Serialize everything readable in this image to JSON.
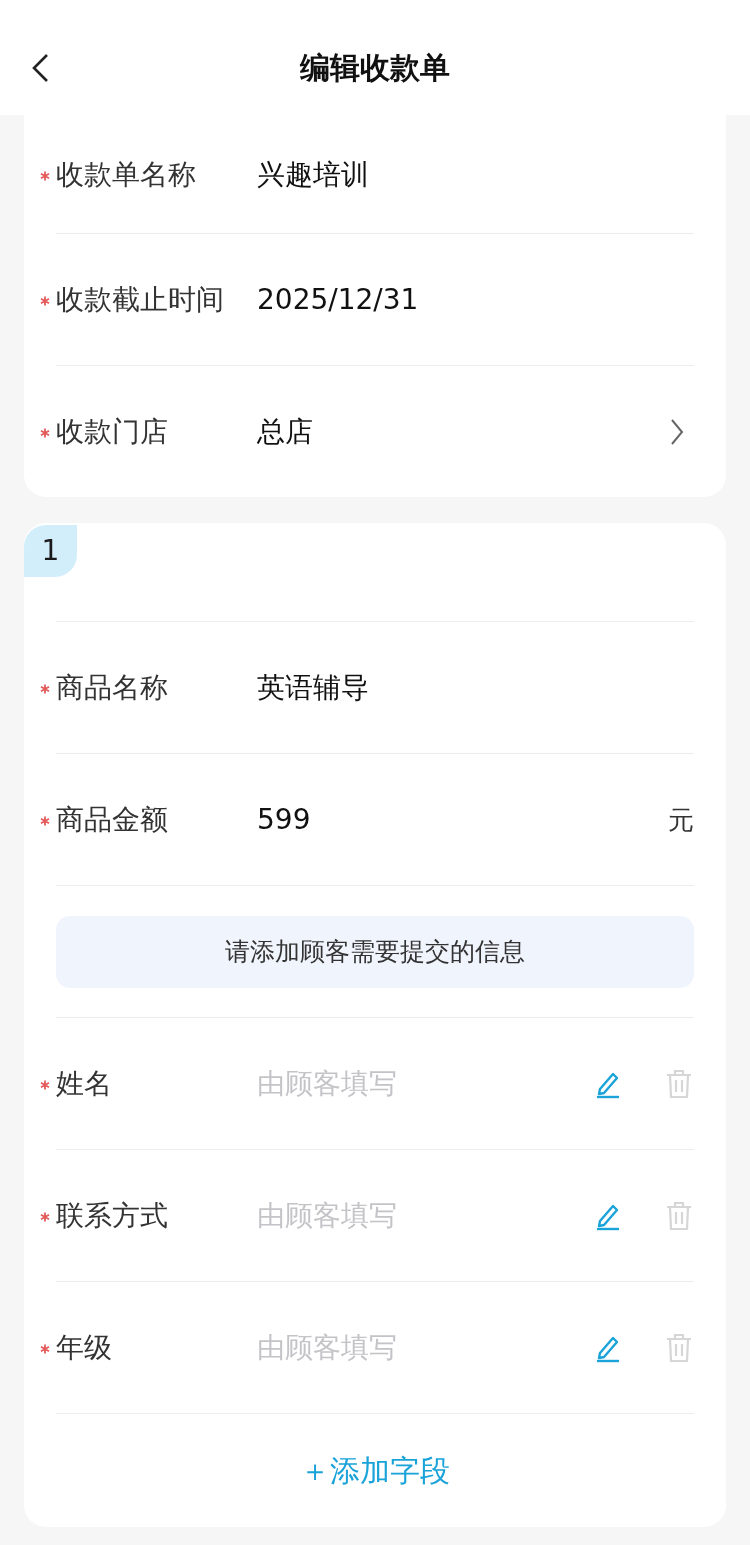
{
  "header": {
    "title": "编辑收款单"
  },
  "basic_fields": [
    {
      "kind": "text",
      "label": "收款单名称",
      "value": "兴趣培训",
      "required": true
    },
    {
      "kind": "text",
      "label": "收款截止时间",
      "value": "2025/12/31",
      "required": true
    },
    {
      "kind": "select",
      "label": "收款门店",
      "value": "总店",
      "required": true
    }
  ],
  "product": {
    "index": "1",
    "fields": [
      {
        "label": "商品名称",
        "value": "英语辅导",
        "required": true
      },
      {
        "label": "商品金额",
        "value": "599",
        "unit": "元",
        "required": true
      }
    ],
    "notice": "请添加顾客需要提交的信息",
    "custom_fields": [
      {
        "label": "姓名",
        "placeholder": "由顾客填写",
        "required": true,
        "delete_disabled": true
      },
      {
        "label": "联系方式",
        "placeholder": "由顾客填写",
        "required": true,
        "delete_disabled": true
      },
      {
        "label": "年级",
        "placeholder": "由顾客填写",
        "required": true,
        "delete_disabled": true
      }
    ],
    "add_button": "＋添加字段"
  }
}
